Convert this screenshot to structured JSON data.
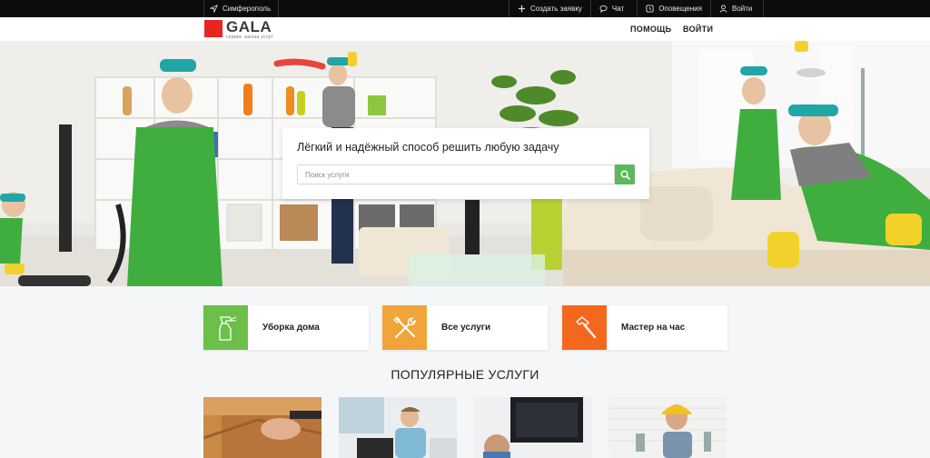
{
  "topbar": {
    "city": "Симферополь",
    "create_request": "Создать заявку",
    "chat": "Чат",
    "notifications": "Оповещения",
    "login": "Войти"
  },
  "header": {
    "brand": "GALA",
    "tagline": "сервис заказа услуг",
    "nav_help": "ПОМОЩЬ",
    "nav_login": "ВОЙТИ"
  },
  "hero": {
    "title": "Лёгкий и надёжный способ решить любую задачу",
    "search_placeholder": "Поиск услуги"
  },
  "categories": [
    {
      "label": "Уборка дома",
      "color": "#6cc04a"
    },
    {
      "label": "Все услуги",
      "color": "#f0a43a"
    },
    {
      "label": "Мастер на час",
      "color": "#f4681e"
    }
  ],
  "popular": {
    "title": "ПОПУЛЯРНЫЕ УСЛУГИ"
  },
  "colors": {
    "accent_green": "#5cb85c",
    "brand_red": "#e8251f",
    "topbar_bg": "#0c0c0c"
  }
}
